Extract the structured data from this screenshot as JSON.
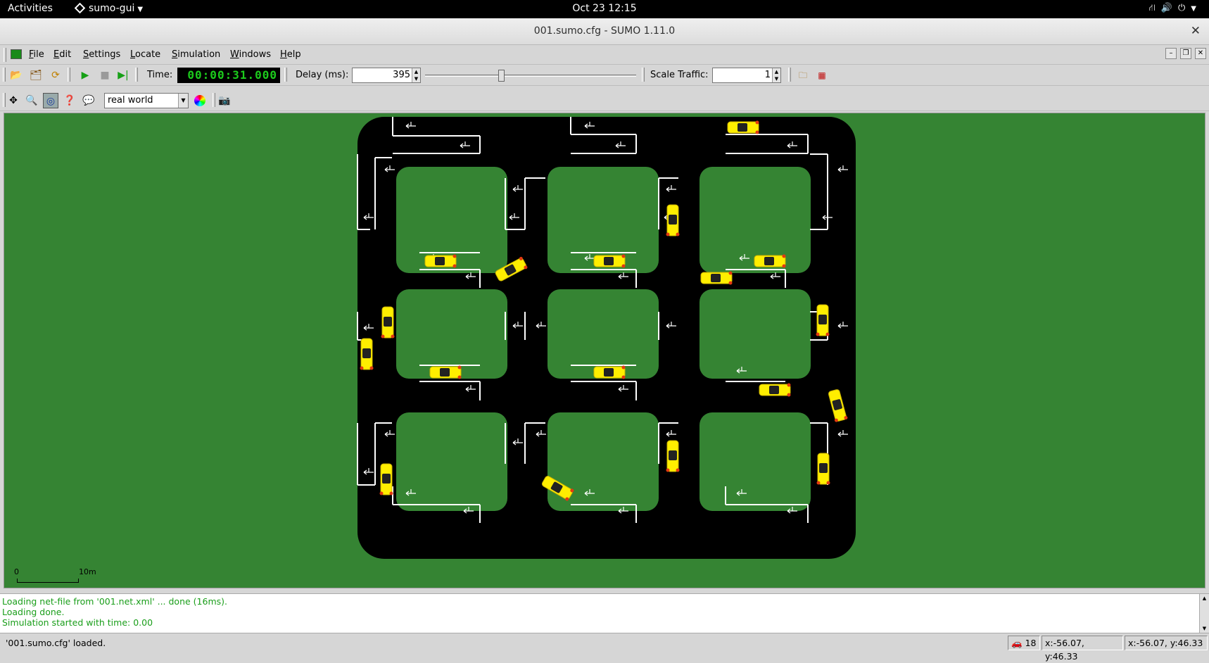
{
  "topbar": {
    "activities": "Activities",
    "app_name": "sumo-gui",
    "clock": "Oct 23  12:15",
    "tray_icons": [
      "network-icon",
      "volume-icon",
      "power-icon"
    ]
  },
  "window": {
    "title": "001.sumo.cfg - SUMO 1.11.0"
  },
  "menu": {
    "items": [
      "File",
      "Edit",
      "Settings",
      "Locate",
      "Simulation",
      "Windows",
      "Help"
    ]
  },
  "toolbar": {
    "time_label": "Time:",
    "time_value": "00:00:31.000",
    "delay_label": "Delay (ms):",
    "delay_value": "395",
    "delay_slider_fraction": 0.36,
    "scale_label": "Scale Traffic:",
    "scale_value": "1"
  },
  "view": {
    "scheme": "real world",
    "scale_zero": "0",
    "scale_ten": "10m"
  },
  "colors": {
    "grass": "#358433",
    "road": "#000000",
    "vehicle": "#ffee00",
    "time_digits": "#1ccb1c",
    "log_text": "#1a9e1a"
  },
  "log": {
    "lines": [
      "Loading net-file from '001.net.xml' ... done (16ms).",
      "Loading done.",
      "Simulation started with time: 0.00"
    ]
  },
  "status": {
    "message": "'001.sumo.cfg' loaded.",
    "vehicle_count": "18",
    "coord_a": "x:-56.07, y:46.33",
    "coord_b": "x:-56.07, y:46.33"
  }
}
